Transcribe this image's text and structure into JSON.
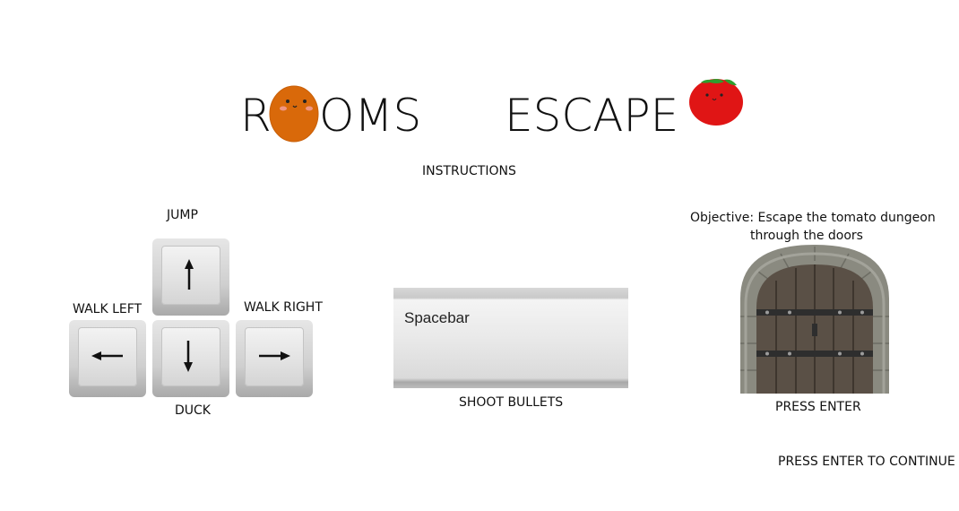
{
  "title": {
    "word1_first": "R",
    "word1_rest": "OMS",
    "word2": "ESCAPE",
    "mascot_icon": "potato-character-icon",
    "tomato_icon": "tomato-character-icon"
  },
  "instructions_heading": "INSTRUCTIONS",
  "controls": {
    "jump_label": "JUMP",
    "walk_left_label": "WALK LEFT",
    "walk_right_label": "WALK RIGHT",
    "duck_label": "DUCK",
    "keys": [
      {
        "name": "up-arrow-key",
        "icon": "arrow-up-icon"
      },
      {
        "name": "left-arrow-key",
        "icon": "arrow-left-icon"
      },
      {
        "name": "down-arrow-key",
        "icon": "arrow-down-icon"
      },
      {
        "name": "right-arrow-key",
        "icon": "arrow-right-icon"
      }
    ]
  },
  "shoot": {
    "key_label": "Spacebar",
    "action_label": "SHOOT BULLETS"
  },
  "objective": {
    "line1": "Objective: Escape the tomato dungeon",
    "line2": "through the doors",
    "door_icon": "dungeon-door-icon",
    "action_label": "PRESS ENTER"
  },
  "continue_prompt": "PRESS ENTER TO CONTINUE",
  "colors": {
    "potato": "#d9690a",
    "tomato": "#e01515",
    "tomato_leaf": "#2f9e2f",
    "door_wood": "#5a5046",
    "door_stone": "#8a8a80"
  }
}
